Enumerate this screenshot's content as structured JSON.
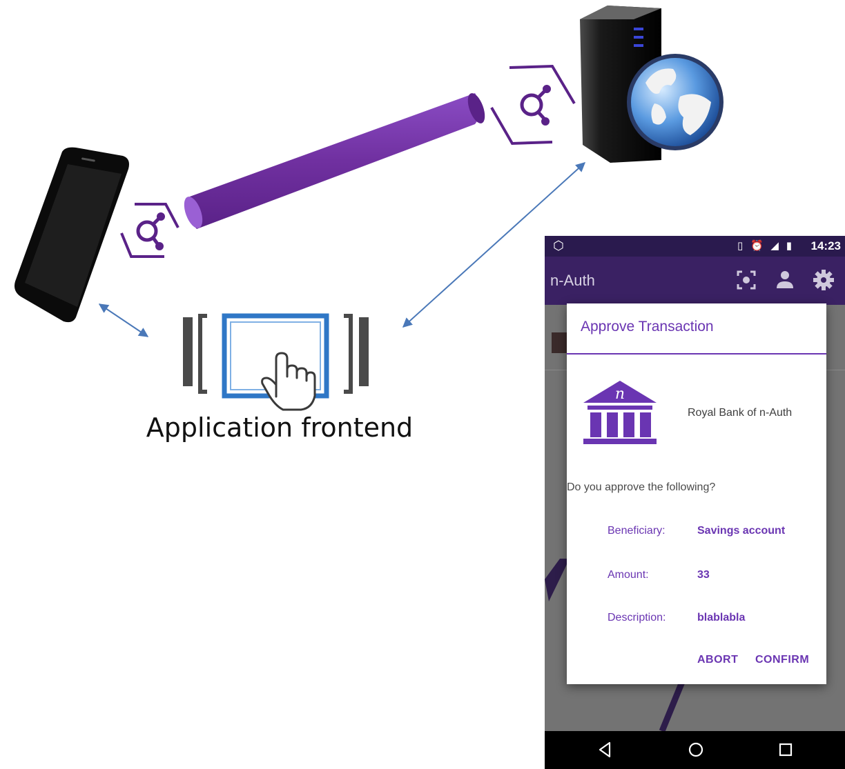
{
  "diagram": {
    "frontend_label": "Application frontend",
    "channel_color": "#7030a0",
    "arrow_color": "#4a78b8",
    "icons": [
      "phone-icon",
      "secure-channel-icon",
      "server-icon",
      "globe-icon",
      "touch-frontend-icon"
    ]
  },
  "phone_screen": {
    "status_time": "14:23",
    "app_title": "n-Auth",
    "accent_color": "#6a35b2",
    "dialog": {
      "title": "Approve Transaction",
      "bank_logo_letter": "n",
      "bank_name": "Royal Bank of n-Auth",
      "question": "Do you approve the following?",
      "rows": [
        {
          "label": "Beneficiary:",
          "value": "Savings account"
        },
        {
          "label": "Amount:",
          "value": "33"
        },
        {
          "label": "Description:",
          "value": "blablabla"
        }
      ],
      "abort_label": "ABORT",
      "confirm_label": "CONFIRM"
    }
  }
}
